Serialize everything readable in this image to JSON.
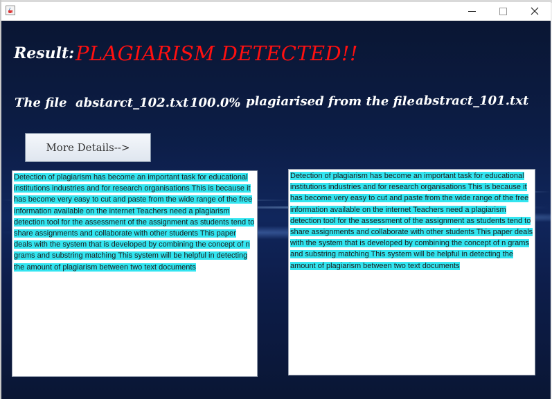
{
  "window": {
    "icon": "java-cup-icon",
    "controls": {
      "minimize": "—",
      "maximize": "☐",
      "close": "✕"
    }
  },
  "result": {
    "label": "Result:",
    "status": "PLAGIARISM DETECTED!!",
    "status_color": "#ff1010"
  },
  "summary": {
    "prefix": "The file",
    "file_checked": "abstarct_102.txt",
    "percent": "100.0%",
    "middle": "plagiarised from the file",
    "source_file": "abstract_101.txt"
  },
  "actions": {
    "more_details_label": "More Details-->"
  },
  "documents": {
    "left_text": "Detection of plagiarism has become an important task for educational institutions industries and for research organisations This is because it has become very easy to cut and paste from the wide range of the free information available on the internet Teachers need a plagiarism detection tool for the assessment of the assignment as students tend to share assignments and collaborate with other students This paper deals with the system that is developed by combining the concept of n grams and substring matching This system will be helpful in detecting the amount of plagiarism between two text documents",
    "right_text": "Detection of plagiarism has become an important task for educational institutions industries and for research organisations This is because it has become very easy to cut and paste from the wide range of the free information available on the internet Teachers need a plagiarism detection tool for the assessment of the assignment as students tend to share assignments and collaborate with other students This paper deals with the system that is developed by combining the concept of n grams and substring matching This system will be helpful in detecting the amount of plagiarism between two text documents",
    "highlight_color": "#33e5f0"
  }
}
